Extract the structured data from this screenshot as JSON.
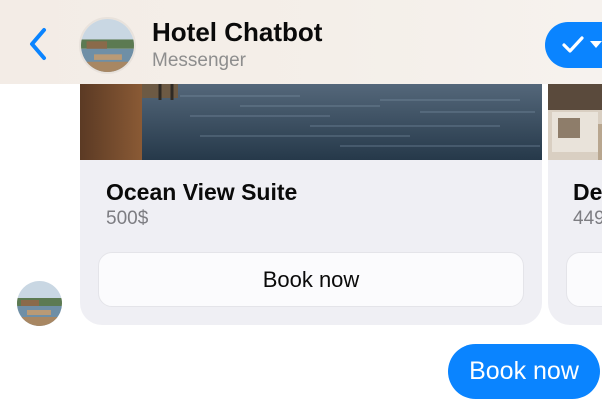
{
  "header": {
    "title": "Hotel Chatbot",
    "subtitle": "Messenger",
    "back_icon": "chevron-left-icon",
    "done_icon": "checkmark-icon",
    "accent_color": "#0a84ff"
  },
  "carousel": {
    "cards": [
      {
        "title": "Ocean View Suite",
        "price": "500$",
        "button_label": "Book now"
      },
      {
        "title": "De",
        "price": "449",
        "button_label": ""
      }
    ]
  },
  "messages": {
    "user_reply": "Book now"
  }
}
